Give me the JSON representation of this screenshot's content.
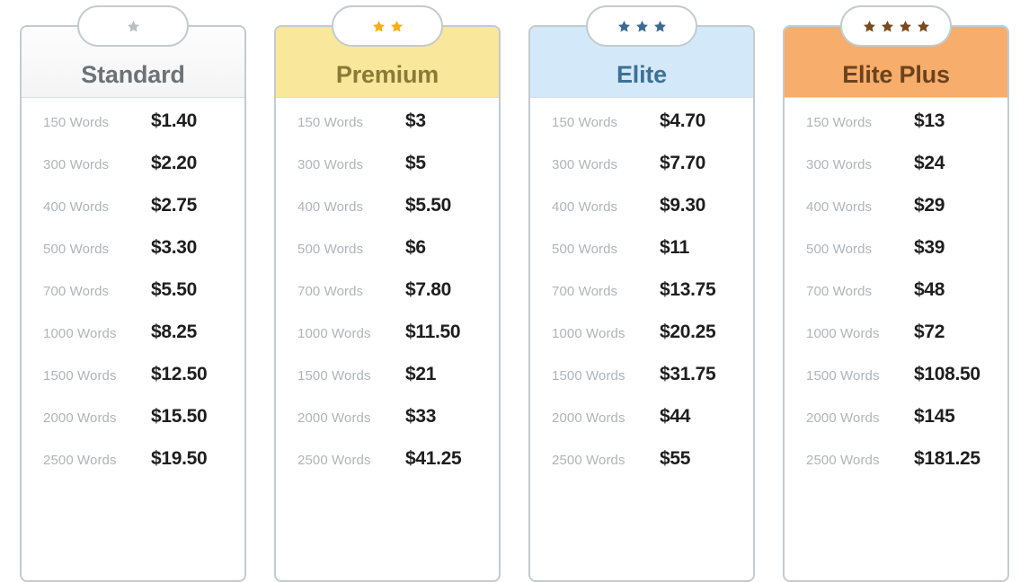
{
  "plans": [
    {
      "name": "Standard",
      "theme": "standard",
      "star_count": 1,
      "star_color": "#b9c0c4",
      "header_bg": "#f7f7f7",
      "title_color": "#6d7276",
      "badge_name": "standard-badge",
      "rows": [
        {
          "words": "150 Words",
          "price": "$1.40"
        },
        {
          "words": "300 Words",
          "price": "$2.20"
        },
        {
          "words": "400 Words",
          "price": "$2.75"
        },
        {
          "words": "500 Words",
          "price": "$3.30"
        },
        {
          "words": "700 Words",
          "price": "$5.50"
        },
        {
          "words": "1000 Words",
          "price": "$8.25"
        },
        {
          "words": "1500 Words",
          "price": "$12.50"
        },
        {
          "words": "2000 Words",
          "price": "$15.50"
        },
        {
          "words": "2500 Words",
          "price": "$19.50"
        }
      ]
    },
    {
      "name": "Premium",
      "theme": "premium",
      "star_count": 2,
      "star_color": "#fbae17",
      "header_bg": "#f9e79c",
      "title_color": "#8a7a35",
      "badge_name": "premium-badge",
      "rows": [
        {
          "words": "150 Words",
          "price": "$3"
        },
        {
          "words": "300 Words",
          "price": "$5"
        },
        {
          "words": "400 Words",
          "price": "$5.50"
        },
        {
          "words": "500 Words",
          "price": "$6"
        },
        {
          "words": "700 Words",
          "price": "$7.80"
        },
        {
          "words": "1000 Words",
          "price": "$11.50"
        },
        {
          "words": "1500 Words",
          "price": "$21"
        },
        {
          "words": "2000 Words",
          "price": "$33"
        },
        {
          "words": "2500 Words",
          "price": "$41.25"
        }
      ]
    },
    {
      "name": "Elite",
      "theme": "elite",
      "star_count": 3,
      "star_color": "#3b6b93",
      "header_bg": "#d3e9f9",
      "title_color": "#3d7196",
      "badge_name": "elite-badge",
      "rows": [
        {
          "words": "150 Words",
          "price": "$4.70"
        },
        {
          "words": "300 Words",
          "price": "$7.70"
        },
        {
          "words": "400 Words",
          "price": "$9.30"
        },
        {
          "words": "500 Words",
          "price": "$11"
        },
        {
          "words": "700 Words",
          "price": "$13.75"
        },
        {
          "words": "1000 Words",
          "price": "$20.25"
        },
        {
          "words": "1500 Words",
          "price": "$31.75"
        },
        {
          "words": "2000 Words",
          "price": "$44"
        },
        {
          "words": "2500 Words",
          "price": "$55"
        }
      ]
    },
    {
      "name": "Elite Plus",
      "theme": "eliteplus",
      "star_count": 4,
      "star_color": "#7a4a1e",
      "header_bg": "#f7ad6b",
      "title_color": "#6b431d",
      "badge_name": "elite-plus-badge",
      "rows": [
        {
          "words": "150 Words",
          "price": "$13"
        },
        {
          "words": "300 Words",
          "price": "$24"
        },
        {
          "words": "400 Words",
          "price": "$29"
        },
        {
          "words": "500 Words",
          "price": "$39"
        },
        {
          "words": "700 Words",
          "price": "$48"
        },
        {
          "words": "1000 Words",
          "price": "$72"
        },
        {
          "words": "1500 Words",
          "price": "$108.50"
        },
        {
          "words": "2000 Words",
          "price": "$145"
        },
        {
          "words": "2500 Words",
          "price": "$181.25"
        }
      ]
    }
  ],
  "icons": {
    "star": "star-icon"
  },
  "colors": {
    "card_border": "#c3cbcf",
    "row_label": "#b0b4b8",
    "row_price": "#1e1e1e"
  }
}
